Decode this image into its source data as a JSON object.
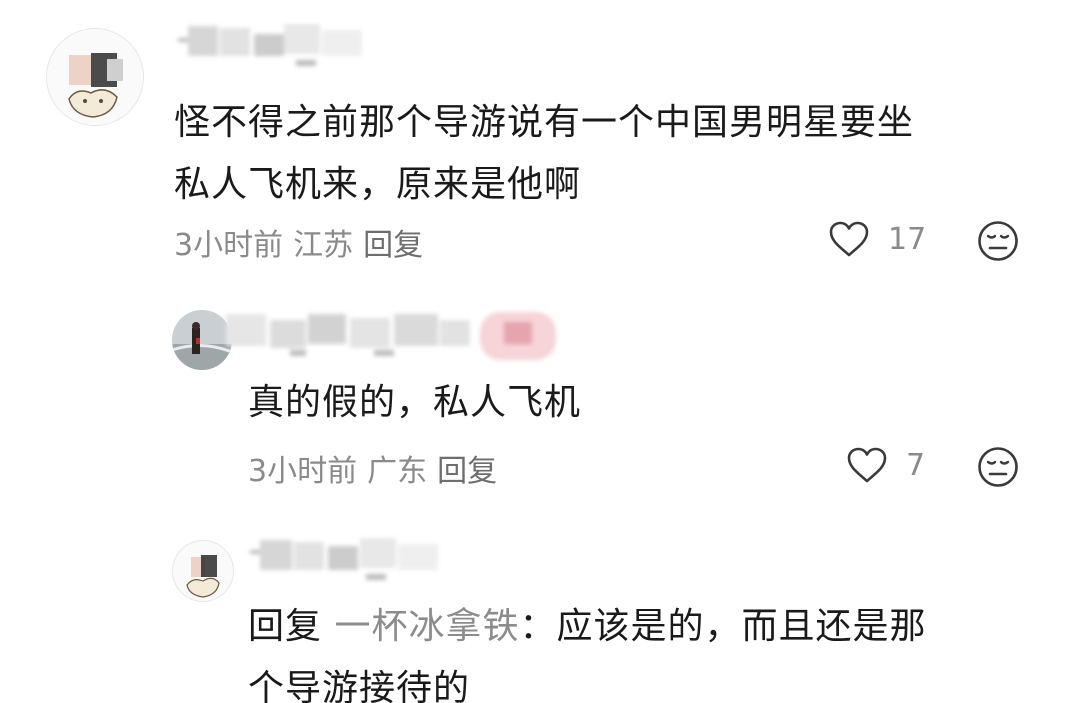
{
  "comments": [
    {
      "text_line1": "怪不得之前那个导游说有一个中国男明星要坐",
      "text_line2": "私人飞机来，原来是他啊",
      "time": "3小时前",
      "location": "江苏",
      "reply_label": "回复",
      "likes": "17"
    },
    {
      "text": "真的假的，私人飞机",
      "time": "3小时前",
      "location": "广东",
      "reply_label": "回复",
      "likes": "7"
    },
    {
      "reply_prefix": "回复",
      "reply_to": "一杯冰拿铁",
      "text_line1_rest": "：应该是的，而且还是那",
      "text_line2": "个导游接待的"
    }
  ],
  "icons": {
    "like": "heart-outline-icon",
    "dislike": "unamused-face-icon"
  },
  "colors": {
    "text": "#1a1a1a",
    "meta": "#8a8a8a",
    "icon": "#3a3a3a"
  }
}
